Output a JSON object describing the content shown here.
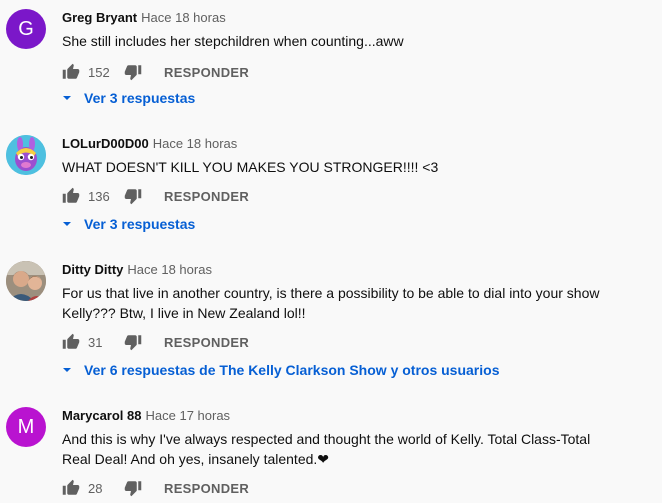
{
  "colors": {
    "background": "#f9f9f9",
    "link_blue": "#065fd4",
    "meta_gray": "#606060",
    "avatar_g": "#7b17c9",
    "avatar_m": "#b913d0"
  },
  "comments": [
    {
      "author": "Greg Bryant",
      "time": "Hace 18 horas",
      "avatar_letter": "G",
      "text": "She still includes her stepchildren when counting...aww",
      "likes": "152",
      "reply_label": "RESPONDER",
      "replies_label": "Ver 3 respuestas"
    },
    {
      "author": "LOLurD00D00",
      "time": "Hace 18 horas",
      "avatar_icon": "llama-avatar-icon",
      "text": "WHAT DOESN'T KILL YOU MAKES YOU STRONGER!!!! <3",
      "likes": "136",
      "reply_label": "RESPONDER",
      "replies_label": "Ver 3 respuestas"
    },
    {
      "author": "Ditty Ditty",
      "time": "Hace 18 horas",
      "avatar_icon": "photo-avatar-icon",
      "text": "For us that live in another country, is there a possibility to be able to dial into your show Kelly??? Btw, I live in New Zealand lol!!",
      "likes": "31",
      "reply_label": "RESPONDER",
      "replies_label": "Ver 6 respuestas de The Kelly Clarkson Show y otros usuarios"
    },
    {
      "author": "Marycarol 88",
      "time": "Hace 17 horas",
      "avatar_letter": "M",
      "text": "And this is why I've always respected and thought  the world of Kelly.  Total Class-Total Real Deal! And oh yes, insanely talented.❤",
      "likes": "28",
      "reply_label": "RESPONDER"
    }
  ]
}
